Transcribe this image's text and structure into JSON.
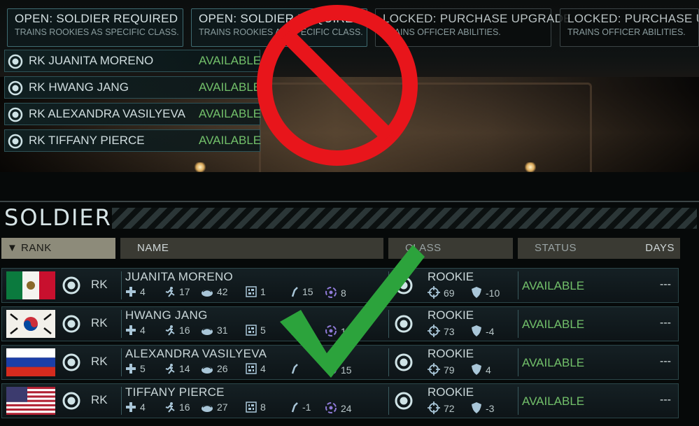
{
  "upgrade_cards": [
    {
      "title": "OPEN: SOLDIER REQUIRED",
      "subtitle": "TRAINS ROOKIES AS SPECIFIC CLASS.",
      "state": "open"
    },
    {
      "title": "OPEN: SOLDIER REQUIRED",
      "subtitle": "TRAINS ROOKIES AS SPECIFIC CLASS.",
      "state": "open"
    },
    {
      "title": "LOCKED: PURCHASE UPGRADE",
      "subtitle": "TRAINS OFFICER ABILITIES.",
      "state": "locked"
    },
    {
      "title": "LOCKED: PURCHASE UPGRADE",
      "subtitle": "TRAINS OFFICER ABILITIES.",
      "state": "locked"
    }
  ],
  "picker_list": [
    {
      "name": "RK JUANITA MORENO",
      "status": "AVAILABLE"
    },
    {
      "name": "RK HWANG JANG",
      "status": "AVAILABLE"
    },
    {
      "name": "RK ALEXANDRA VASILYEVA",
      "status": "AVAILABLE"
    },
    {
      "name": "RK TIFFANY PIERCE",
      "status": "AVAILABLE"
    }
  ],
  "soldiers_panel": {
    "title": "SOLDIERS",
    "columns": {
      "rank": "RANK",
      "name": "NAME",
      "class": "CLASS",
      "status": "STATUS",
      "days": "DAYS"
    }
  },
  "soldiers": [
    {
      "flag": "mexico-flag",
      "rank": "RK",
      "name": "JUANITA MORENO",
      "heal": "4",
      "mobility": "17",
      "will": "42",
      "hack": "1",
      "dodge": "15",
      "psi": "8",
      "class": "ROOKIE",
      "aim": "69",
      "defense": "-10",
      "status": "AVAILABLE",
      "days": "---"
    },
    {
      "flag": "south-korea-flag",
      "rank": "RK",
      "name": "HWANG JANG",
      "heal": "4",
      "mobility": "16",
      "will": "31",
      "hack": "5",
      "dodge": "",
      "psi": "17",
      "class": "ROOKIE",
      "aim": "73",
      "defense": "-4",
      "status": "AVAILABLE",
      "days": "---"
    },
    {
      "flag": "russia-flag",
      "rank": "RK",
      "name": "ALEXANDRA VASILYEVA",
      "heal": "5",
      "mobility": "14",
      "will": "26",
      "hack": "4",
      "dodge": "",
      "psi": "15",
      "class": "ROOKIE",
      "aim": "79",
      "defense": "4",
      "status": "AVAILABLE",
      "days": "---"
    },
    {
      "flag": "usa-flag",
      "rank": "RK",
      "name": "TIFFANY PIERCE",
      "heal": "4",
      "mobility": "16",
      "will": "27",
      "hack": "8",
      "dodge": "-1",
      "psi": "24",
      "class": "ROOKIE",
      "aim": "72",
      "defense": "-3",
      "status": "AVAILABLE",
      "days": "---"
    }
  ],
  "overlays": {
    "prohibited": "prohibited-sign-icon",
    "approved": "check-mark-icon"
  },
  "colors": {
    "available": "#72c06a",
    "accent_border": "#3f6b71",
    "prohibited": "#e8151b",
    "approved": "#2ca33c"
  }
}
